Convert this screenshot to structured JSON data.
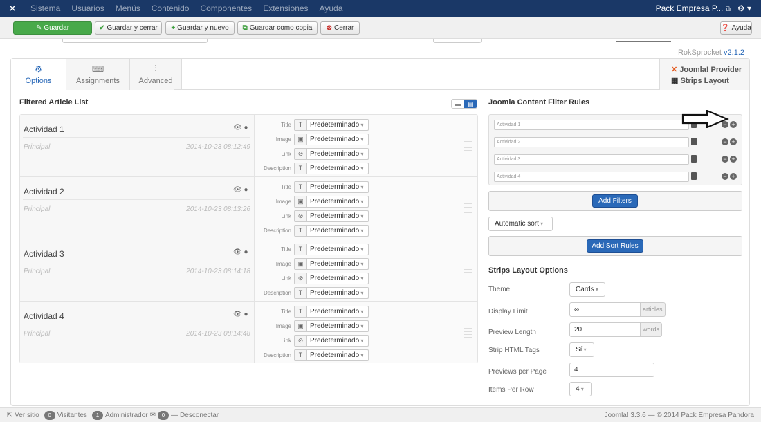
{
  "topbar": {
    "menu": [
      "Sistema",
      "Usuarios",
      "Menús",
      "Contenido",
      "Componentes",
      "Extensiones",
      "Ayuda"
    ],
    "site_name": "Pack Empresa P...",
    "ext_icon": "external-link-icon",
    "settings_icon": "gear-icon"
  },
  "toolbar": {
    "save": "Guardar",
    "save_close": "Guardar y cerrar",
    "save_new": "Guardar y nuevo",
    "save_copy": "Guardar como copia",
    "close": "Cerrar",
    "help": "Ayuda"
  },
  "version": {
    "label": "RokSprocket",
    "number": "v2.1.2"
  },
  "tabs": [
    {
      "label": "Options",
      "icon": "gear-icon",
      "active": true
    },
    {
      "label": "Assignments",
      "icon": "keyboard-icon",
      "active": false
    },
    {
      "label": "Advanced",
      "icon": "sliders-icon",
      "active": false
    }
  ],
  "provider": {
    "line1": "Joomla! Provider",
    "line2": "Strips Layout"
  },
  "list": {
    "title": "Filtered Article List",
    "field_labels": [
      "Title",
      "Image",
      "Link",
      "Description"
    ],
    "field_value": "Predeterminado",
    "articles": [
      {
        "title": "Actividad 1",
        "category": "Principal",
        "date": "2014-10-23 08:12:49"
      },
      {
        "title": "Actividad 2",
        "category": "Principal",
        "date": "2014-10-23 08:13:26"
      },
      {
        "title": "Actividad 3",
        "category": "Principal",
        "date": "2014-10-23 08:14:18"
      },
      {
        "title": "Actividad 4",
        "category": "Principal",
        "date": "2014-10-23 08:14:48"
      }
    ]
  },
  "filters": {
    "title": "Joomla Content Filter Rules",
    "rules": [
      "Actividad 1",
      "Actividad 2",
      "Actividad 3",
      "Actividad 4"
    ],
    "add_filters": "Add Filters",
    "sort": "Automatic sort",
    "add_sort": "Add Sort Rules"
  },
  "layout_options": {
    "title": "Strips Layout Options",
    "theme_label": "Theme",
    "theme_value": "Cards",
    "display_limit_label": "Display Limit",
    "display_limit_value": "∞",
    "display_limit_unit": "articles",
    "preview_length_label": "Preview Length",
    "preview_length_value": "20",
    "preview_length_unit": "words",
    "strip_html_label": "Strip HTML Tags",
    "strip_html_value": "Sí",
    "previews_per_page_label": "Previews per Page",
    "previews_per_page_value": "4",
    "items_per_row_label": "Items Per Row",
    "items_per_row_value": "4"
  },
  "footer": {
    "view_site": "Ver sitio",
    "visitors_count": "0",
    "visitors": "Visitantes",
    "admin_count": "1",
    "admin": "Administrador",
    "messages_count": "0",
    "logout": "Desconectar",
    "copyright": "Joomla! 3.3.6 — © 2014 Pack Empresa Pandora"
  },
  "colors": {
    "topbar": "#1a3867",
    "save": "#48a94a",
    "accent": "#2a69b8"
  }
}
